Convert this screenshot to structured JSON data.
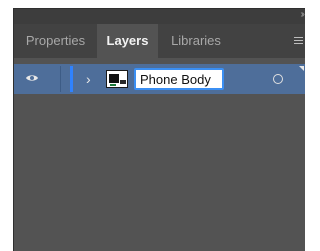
{
  "panel": {
    "tabs": [
      {
        "label": "Properties",
        "active": false
      },
      {
        "label": "Layers",
        "active": true
      },
      {
        "label": "Libraries",
        "active": false
      }
    ],
    "collapse_icon": "double-chevron-icon",
    "menu_icon": "panel-menu-icon"
  },
  "layers": [
    {
      "name": "Phone Body",
      "visible": true,
      "expanded": false,
      "layer_color": "#2f82ff",
      "selected": true,
      "editing_name": true
    }
  ],
  "colors": {
    "panel_bg": "#535353",
    "tab_bar_bg": "#424242",
    "selected_row": "#4e6e9a",
    "focus_ring": "#3b8ff3"
  }
}
